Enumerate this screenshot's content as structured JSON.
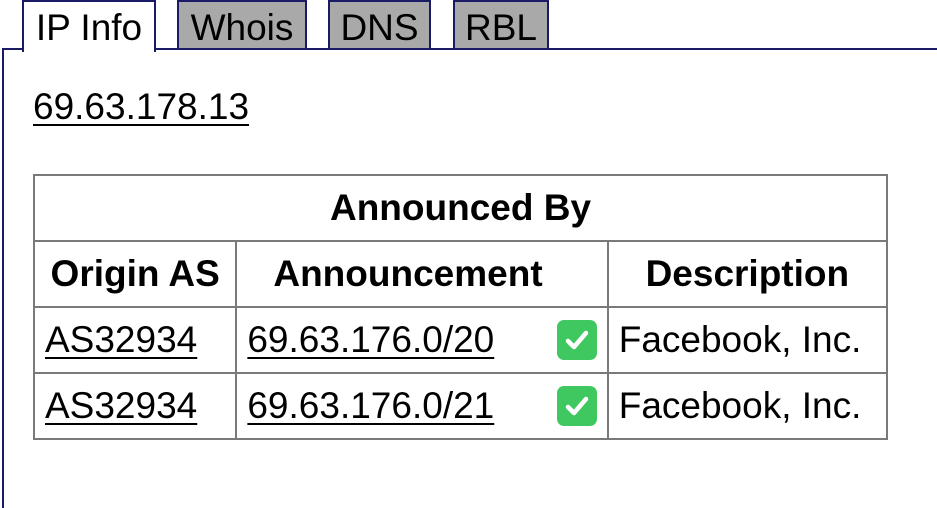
{
  "tabs": [
    {
      "label": "IP Info",
      "active": true
    },
    {
      "label": "Whois",
      "active": false
    },
    {
      "label": "DNS",
      "active": false
    },
    {
      "label": "RBL",
      "active": false
    }
  ],
  "ip_address": "69.63.178.13",
  "announced_table": {
    "title": "Announced By",
    "headers": {
      "origin_as": "Origin AS",
      "announcement": "Announcement",
      "description": "Description"
    },
    "rows": [
      {
        "origin_as": "AS32934",
        "announcement": "69.63.176.0/20",
        "valid_icon": "check-mark-icon",
        "description": "Facebook, Inc."
      },
      {
        "origin_as": "AS32934",
        "announcement": "69.63.176.0/21",
        "valid_icon": "check-mark-icon",
        "description": "Facebook, Inc."
      }
    ]
  },
  "colors": {
    "tab_border": "#1a1a66",
    "inactive_tab_bg": "#a9a9a9",
    "table_border": "#7a7a7a",
    "check_green": "#40c860"
  }
}
